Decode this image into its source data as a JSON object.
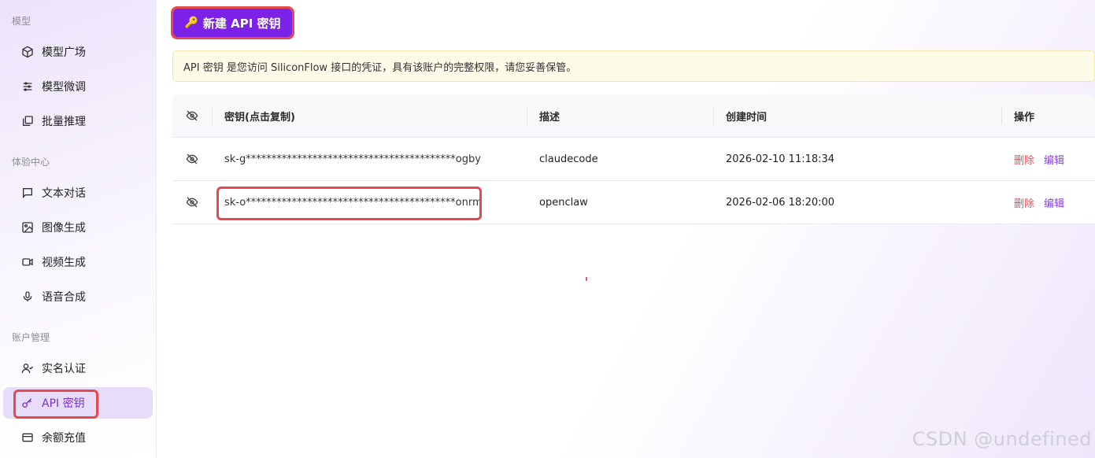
{
  "sidebar": {
    "sections": [
      {
        "label": "模型"
      },
      {
        "label": "体验中心"
      },
      {
        "label": "账户管理"
      }
    ],
    "items": [
      {
        "label": "模型广场",
        "icon": "cube-icon"
      },
      {
        "label": "模型微调",
        "icon": "sliders-icon"
      },
      {
        "label": "批量推理",
        "icon": "batch-icon"
      },
      {
        "label": "文本对话",
        "icon": "chat-icon"
      },
      {
        "label": "图像生成",
        "icon": "image-icon"
      },
      {
        "label": "视频生成",
        "icon": "video-icon"
      },
      {
        "label": "语音合成",
        "icon": "mic-icon"
      },
      {
        "label": "实名认证",
        "icon": "user-check-icon"
      },
      {
        "label": "API 密钥",
        "icon": "key-icon",
        "active": true
      },
      {
        "label": "余额充值",
        "icon": "card-icon"
      }
    ]
  },
  "toolbar": {
    "new_key_label": "新建 API 密钥"
  },
  "notice": {
    "text": "API 密钥 是您访问 SiliconFlow 接口的凭证，具有该账户的完整权限，请您妥善保管。"
  },
  "table": {
    "headers": {
      "key": "密钥(点击复制)",
      "desc": "描述",
      "time": "创建时间",
      "action": "操作"
    },
    "rows": [
      {
        "key": "sk-g*****************************************ogby",
        "desc": "claudecode",
        "time": "2026-02-10 11:18:34",
        "delete": "删除",
        "edit": "编辑"
      },
      {
        "key": "sk-o*****************************************onrm",
        "desc": "openclaw",
        "time": "2026-02-06 18:20:00",
        "delete": "删除",
        "edit": "编辑"
      }
    ]
  },
  "watermark": "CSDN @undefined",
  "colors": {
    "accent": "#7c22e8",
    "danger": "#ef4d5a",
    "highlight": "#e5484d"
  }
}
